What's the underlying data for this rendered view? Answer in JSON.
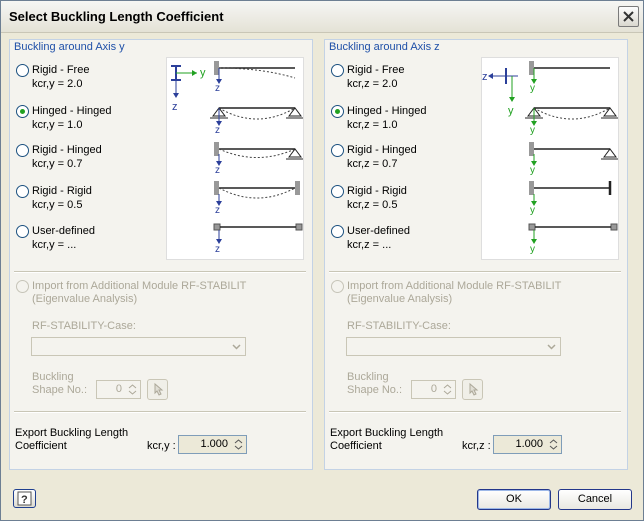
{
  "window": {
    "title": "Select Buckling Length Coefficient"
  },
  "left": {
    "title": "Buckling around Axis y",
    "options": [
      {
        "label": "Rigid - Free",
        "coef": "kcr,y = 2.0",
        "checked": false
      },
      {
        "label": "Hinged - Hinged",
        "coef": "kcr,y = 1.0",
        "checked": true
      },
      {
        "label": "Rigid - Hinged",
        "coef": "kcr,y = 0.7",
        "checked": false
      },
      {
        "label": "Rigid - Rigid",
        "coef": "kcr,y = 0.5",
        "checked": false
      },
      {
        "label": "User-defined",
        "coef": "kcr,y = ...",
        "checked": false
      }
    ],
    "diagram": {
      "axis_horizontal": "y",
      "axis_vertical": "z"
    },
    "import_label_1": "Import from Additional Module RF-STABILIT",
    "import_label_2": "(Eigenvalue Analysis)",
    "case_label": "RF-STABILITY-Case:",
    "shape_label_1": "Buckling",
    "shape_label_2": "Shape No.:",
    "shape_value": "0",
    "export_label_1": "Export Buckling Length",
    "export_label_2": "Coefficient",
    "export_key": "kcr,y :",
    "export_value": "1.000"
  },
  "right": {
    "title": "Buckling around Axis z",
    "options": [
      {
        "label": "Rigid - Free",
        "coef": "kcr,z = 2.0",
        "checked": false
      },
      {
        "label": "Hinged - Hinged",
        "coef": "kcr,z = 1.0",
        "checked": true
      },
      {
        "label": "Rigid - Hinged",
        "coef": "kcr,z = 0.7",
        "checked": false
      },
      {
        "label": "Rigid - Rigid",
        "coef": "kcr,z = 0.5",
        "checked": false
      },
      {
        "label": "User-defined",
        "coef": "kcr,z = ...",
        "checked": false
      }
    ],
    "diagram": {
      "axis_horizontal": "z",
      "axis_vertical": "y"
    },
    "import_label_1": "Import from Additional Module RF-STABILIT",
    "import_label_2": "(Eigenvalue Analysis)",
    "case_label": "RF-STABILITY-Case:",
    "shape_label_1": "Buckling",
    "shape_label_2": "Shape No.:",
    "shape_value": "0",
    "export_label_1": "Export Buckling Length",
    "export_label_2": "Coefficient",
    "export_key": "kcr,z :",
    "export_value": "1.000"
  },
  "buttons": {
    "ok": "OK",
    "cancel": "Cancel"
  },
  "colors": {
    "diagram_axis_blue": "#2b3f9a",
    "diagram_axis_green": "#21a121",
    "panel_title": "#1f50a8"
  }
}
